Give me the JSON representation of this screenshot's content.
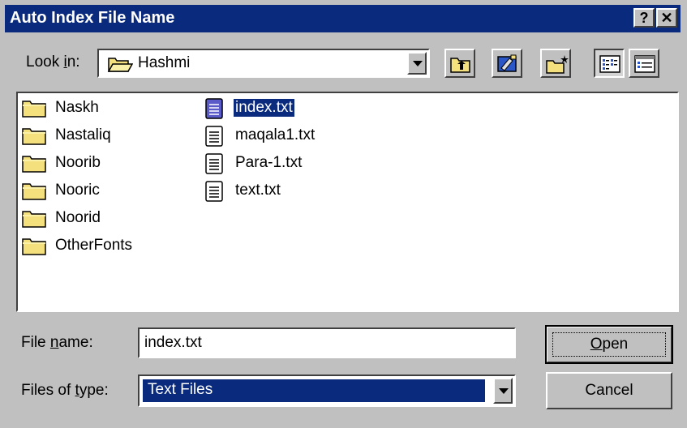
{
  "window": {
    "title": "Auto Index File Name",
    "help_label": "?",
    "close_label": "✕"
  },
  "look_in": {
    "label_pre": "Look ",
    "label_accel": "i",
    "label_post": "n:",
    "value": "Hashmi"
  },
  "toolbar": {
    "buttons": [
      "up-one-level",
      "desktop",
      "create-new-folder",
      "list-view",
      "details-view"
    ]
  },
  "files": {
    "folders": [
      "Naskh",
      "Nastaliq",
      "Noorib",
      "Nooric",
      "Noorid",
      "OtherFonts"
    ],
    "documents": [
      "index.txt",
      "maqala1.txt",
      "Para-1.txt",
      "text.txt"
    ],
    "selected": "index.txt"
  },
  "file_name": {
    "label_pre": "File ",
    "label_accel": "n",
    "label_post": "ame:",
    "value": "index.txt"
  },
  "file_type": {
    "label_pre": "Files of ",
    "label_accel": "t",
    "label_post": "ype:",
    "value": "Text Files"
  },
  "buttons": {
    "open": "Open",
    "cancel": "Cancel"
  },
  "colors": {
    "title_bar": "#0a2a7d",
    "face": "#c0c0c0",
    "selection": "#0a2a7d",
    "folder": "#f4e07c"
  }
}
